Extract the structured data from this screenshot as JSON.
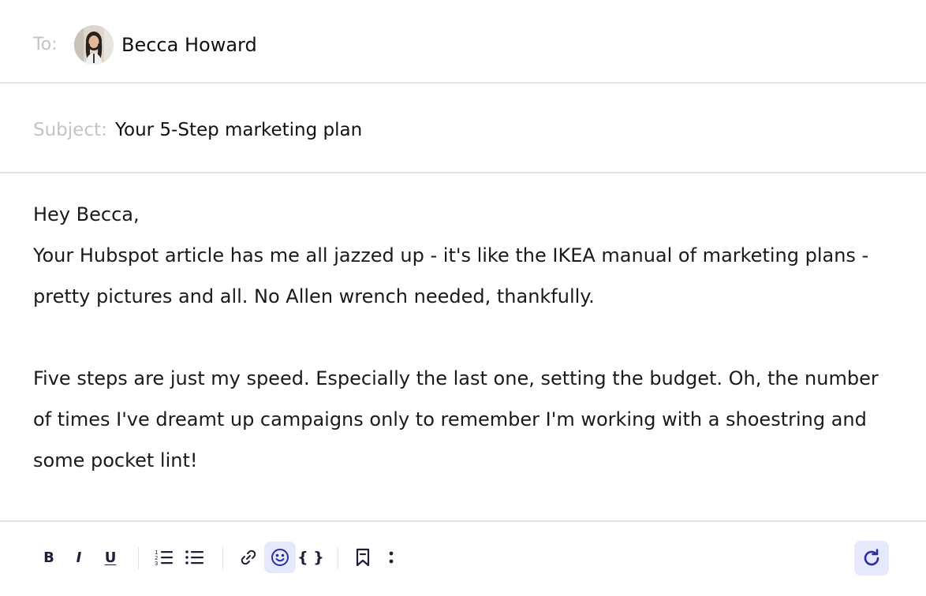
{
  "header": {
    "to_label": "To:",
    "recipient_name": "Becca Howard",
    "subject_label": "Subject:",
    "subject_value": "Your 5-Step marketing plan"
  },
  "body": {
    "greeting": "Hey Becca,",
    "paragraph_1": "Your Hubspot article has me all jazzed up - it's like the IKEA manual of marketing plans - pretty pictures and all. No Allen wrench needed, thankfully.",
    "paragraph_2": "Five steps are just my speed. Especially the last one, setting the budget. Oh, the number of times I've dreamt up campaigns only to remember I'm working with a shoestring and some pocket lint!"
  },
  "toolbar": {
    "bold_label": "B",
    "italic_label": "I",
    "underline_label": "U",
    "braces_label": "{ }",
    "icons": [
      "bold-icon",
      "italic-icon",
      "underline-icon",
      "numbered-list-icon",
      "bullet-list-icon",
      "link-icon",
      "emoji-icon",
      "braces-icon",
      "bookmark-icon",
      "more-vertical-icon",
      "refresh-icon"
    ]
  },
  "colors": {
    "label_gray": "#c4c4c4",
    "accent": "#2a2f9e",
    "accent_bg": "#e6e9fb",
    "divider": "#e4e4e8"
  }
}
